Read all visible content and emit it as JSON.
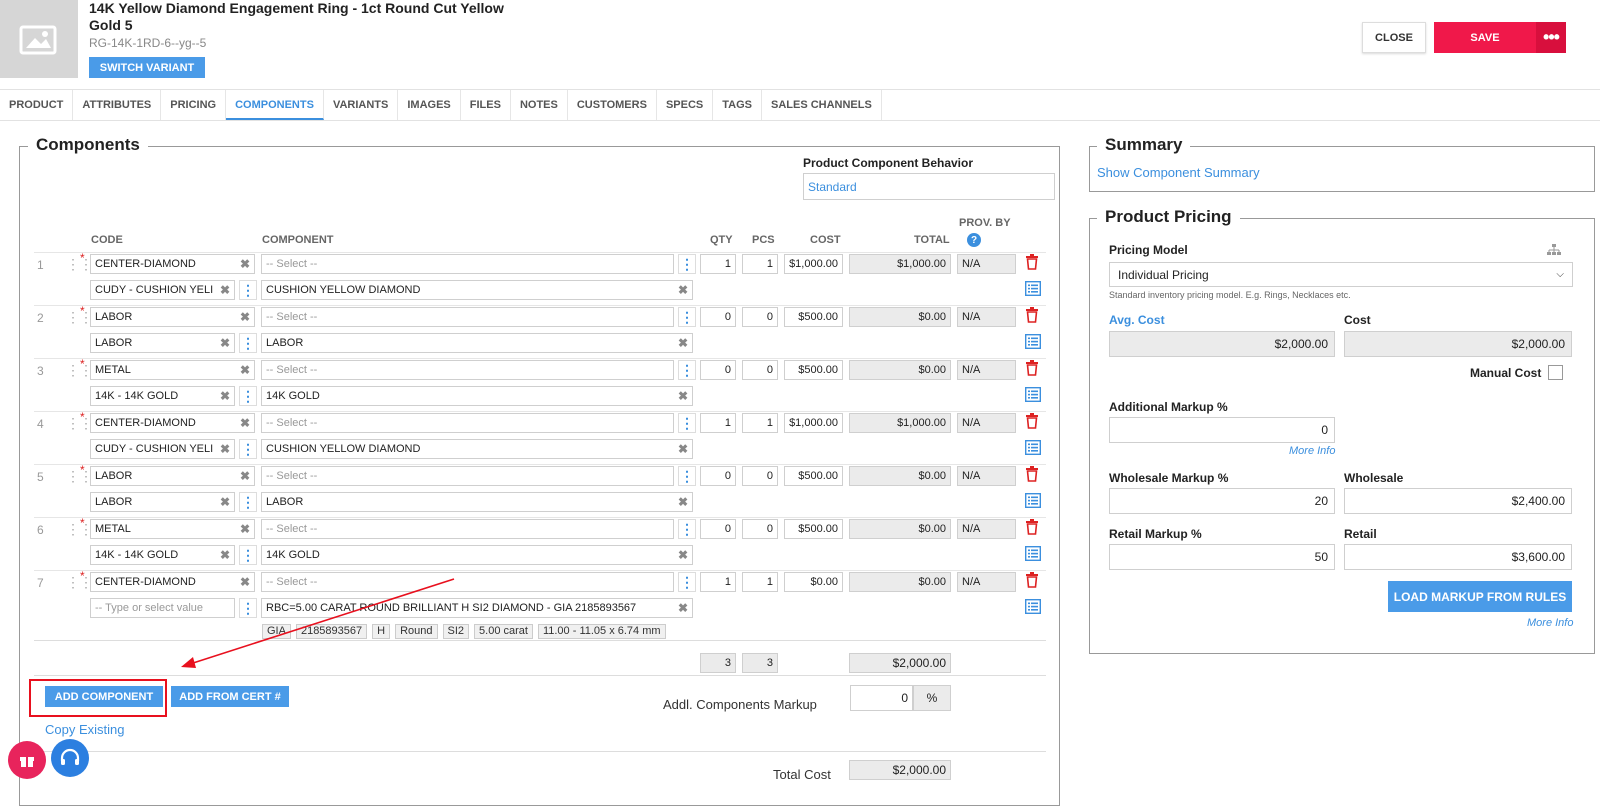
{
  "header": {
    "title": "14K Yellow Diamond Engagement Ring - 1ct Round Cut Yellow Gold 5",
    "sku": "RG-14K-1RD-6--yg--5",
    "switch_variant": "SWITCH VARIANT",
    "close": "CLOSE",
    "save": "SAVE"
  },
  "tabs": [
    "PRODUCT",
    "ATTRIBUTES",
    "PRICING",
    "COMPONENTS",
    "VARIANTS",
    "IMAGES",
    "FILES",
    "NOTES",
    "CUSTOMERS",
    "SPECS",
    "TAGS",
    "SALES CHANNELS"
  ],
  "components": {
    "legend": "Components",
    "behavior_label": "Product Component Behavior",
    "behavior_value": "Standard",
    "columns": {
      "code": "CODE",
      "component": "COMPONENT",
      "qty": "QTY",
      "pcs": "PCS",
      "cost": "COST",
      "total": "TOTAL",
      "prov_by": "PROV. BY"
    },
    "rows": [
      {
        "num": "1",
        "code": "CENTER-DIAMOND",
        "select": "-- Select --",
        "qty": "1",
        "pcs": "1",
        "cost": "$1,000.00",
        "total": "$1,000.00",
        "prov": "N/A",
        "subcode": "CUDY - CUSHION YELI",
        "subcomp": "CUSHION YELLOW DIAMOND"
      },
      {
        "num": "2",
        "code": "LABOR",
        "select": "-- Select --",
        "qty": "0",
        "pcs": "0",
        "cost": "$500.00",
        "total": "$0.00",
        "prov": "N/A",
        "subcode": "LABOR",
        "subcomp": "LABOR"
      },
      {
        "num": "3",
        "code": "METAL",
        "select": "-- Select --",
        "qty": "0",
        "pcs": "0",
        "cost": "$500.00",
        "total": "$0.00",
        "prov": "N/A",
        "subcode": "14K - 14K GOLD",
        "subcomp": "14K GOLD"
      },
      {
        "num": "4",
        "code": "CENTER-DIAMOND",
        "select": "-- Select --",
        "qty": "1",
        "pcs": "1",
        "cost": "$1,000.00",
        "total": "$1,000.00",
        "prov": "N/A",
        "subcode": "CUDY - CUSHION YELI",
        "subcomp": "CUSHION YELLOW DIAMOND"
      },
      {
        "num": "5",
        "code": "LABOR",
        "select": "-- Select --",
        "qty": "0",
        "pcs": "0",
        "cost": "$500.00",
        "total": "$0.00",
        "prov": "N/A",
        "subcode": "LABOR",
        "subcomp": "LABOR"
      },
      {
        "num": "6",
        "code": "METAL",
        "select": "-- Select --",
        "qty": "0",
        "pcs": "0",
        "cost": "$500.00",
        "total": "$0.00",
        "prov": "N/A",
        "subcode": "14K - 14K GOLD",
        "subcomp": "14K GOLD"
      },
      {
        "num": "7",
        "code": "CENTER-DIAMOND",
        "select": "-- Select --",
        "qty": "1",
        "pcs": "1",
        "cost": "$0.00",
        "total": "$0.00",
        "prov": "N/A",
        "subcode": "-- Type or select value",
        "subcomp": "RBC=5.00 CARAT ROUND BRILLIANT H SI2 DIAMOND - GIA 2185893567"
      }
    ],
    "chips": [
      "GIA",
      "2185893567",
      "H",
      "Round",
      "SI2",
      "5.00 carat",
      "11.00 - 11.05 x 6.74 mm"
    ],
    "totals": {
      "qty": "3",
      "pcs": "3",
      "total": "$2,000.00"
    },
    "add_component": "ADD COMPONENT",
    "add_from_cert": "ADD FROM CERT #",
    "copy_existing": "Copy Existing",
    "markup_label": "Addl. Components Markup",
    "markup_value": "0",
    "markup_unit": "%",
    "total_cost_label": "Total Cost",
    "total_cost_value": "$2,000.00"
  },
  "summary": {
    "legend": "Summary",
    "link": "Show Component Summary"
  },
  "pricing": {
    "legend": "Product Pricing",
    "model_label": "Pricing Model",
    "model_value": "Individual Pricing",
    "model_hint": "Standard inventory pricing model. E.g. Rings, Necklaces etc.",
    "avg_cost_label": "Avg. Cost",
    "avg_cost_value": "$2,000.00",
    "cost_label": "Cost",
    "cost_value": "$2,000.00",
    "manual_cost_label": "Manual Cost",
    "add_markup_label": "Additional Markup %",
    "add_markup_value": "0",
    "more_info": "More Info",
    "wholesale_markup_label": "Wholesale Markup %",
    "wholesale_markup_value": "20",
    "wholesale_label": "Wholesale",
    "wholesale_value": "$2,400.00",
    "retail_markup_label": "Retail Markup %",
    "retail_markup_value": "50",
    "retail_label": "Retail",
    "retail_value": "$3,600.00",
    "load_markup": "LOAD MARKUP FROM RULES",
    "more_info2": "More Info"
  },
  "colors": {
    "accent": "#4a9be8",
    "save": "#f0184a",
    "delete": "#d22222",
    "annotation": "#e8101e"
  }
}
